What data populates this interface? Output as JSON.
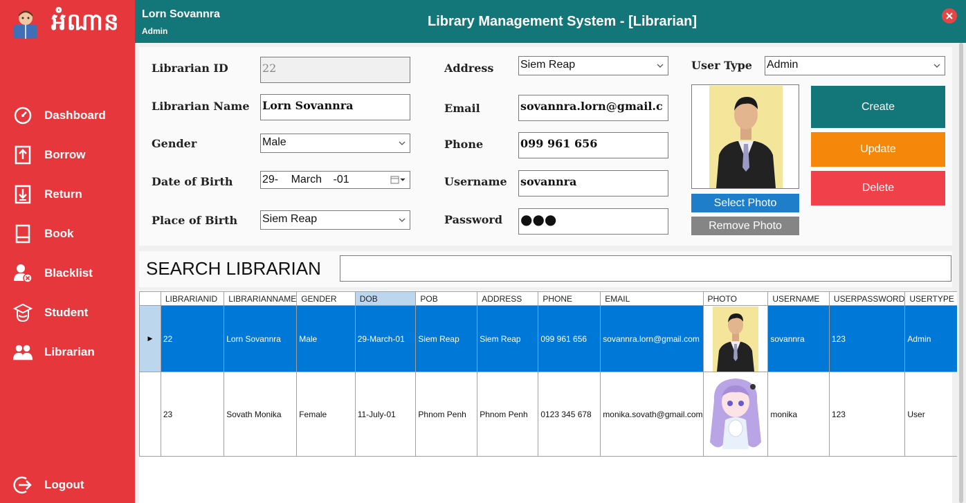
{
  "brand": {
    "logo_text": "អំណាន"
  },
  "sidebar": {
    "items": [
      {
        "label": "Dashboard",
        "icon": "dashboard-gauge-icon"
      },
      {
        "label": "Borrow",
        "icon": "borrow-upload-icon"
      },
      {
        "label": "Return",
        "icon": "return-download-icon"
      },
      {
        "label": "Book",
        "icon": "book-icon"
      },
      {
        "label": "Blacklist",
        "icon": "blacklist-user-icon"
      },
      {
        "label": "Student",
        "icon": "student-icon"
      },
      {
        "label": "Librarian",
        "icon": "librarian-users-icon"
      }
    ],
    "logout": "Logout"
  },
  "header": {
    "user": "Lorn Sovannra",
    "role": "Admin",
    "title": "Library Management System - [Librarian]"
  },
  "form": {
    "librarian_id": {
      "label": "Librarian ID",
      "value": "22"
    },
    "librarian_name": {
      "label": "Librarian Name",
      "value": "Lorn Sovannra"
    },
    "gender": {
      "label": "Gender",
      "value": "Male"
    },
    "dob": {
      "label": "Date of Birth",
      "day": "29-",
      "month": "March",
      "year": "-01"
    },
    "pob": {
      "label": "Place of Birth",
      "value": "Siem Reap"
    },
    "address": {
      "label": "Address",
      "value": "Siem Reap"
    },
    "email": {
      "label": "Email",
      "value": "sovannra.lorn@gmail.c"
    },
    "phone": {
      "label": "Phone",
      "value": "099 961 656"
    },
    "username": {
      "label": "Username",
      "value": "sovannra"
    },
    "password": {
      "label": "Password",
      "value": "●●●"
    },
    "user_type": {
      "label": "User Type",
      "value": "Admin"
    }
  },
  "buttons": {
    "create": "Create",
    "update": "Update",
    "delete": "Delete",
    "select_photo": "Select Photo",
    "remove_photo": "Remove Photo"
  },
  "search": {
    "label": "SEARCH LIBRARIAN",
    "value": ""
  },
  "grid": {
    "columns": [
      "LIBRARIANID",
      "LIBRARIANNAME",
      "GENDER",
      "DOB",
      "POB",
      "ADDRESS",
      "PHONE",
      "EMAIL",
      "PHOTO",
      "USERNAME",
      "USERPASSWORD",
      "USERTYPE"
    ],
    "rows": [
      {
        "id": "22",
        "name": "Lorn Sovannra",
        "gender": "Male",
        "dob": "29-March-01",
        "pob": "Siem Reap",
        "address": "Siem Reap",
        "phone": "099 961 656",
        "email": "sovannra.lorn@gmail.com",
        "username": "sovannra",
        "password": "123",
        "usertype": "Admin"
      },
      {
        "id": "23",
        "name": "Sovath Monika",
        "gender": "Female",
        "dob": "11-July-01",
        "pob": "Phnom Penh",
        "address": "Phnom Penh",
        "phone": "0123 345 678",
        "email": "monika.sovath@gmail.com",
        "username": "monika",
        "password": "123",
        "usertype": "User"
      }
    ]
  },
  "colors": {
    "sidebar": "#e5373c",
    "header": "#13777a",
    "create": "#13777a",
    "update": "#f5870a",
    "delete": "#f0404a",
    "select_photo": "#1e7ec9",
    "remove_photo": "#858585",
    "selected_row": "#0078d7"
  }
}
